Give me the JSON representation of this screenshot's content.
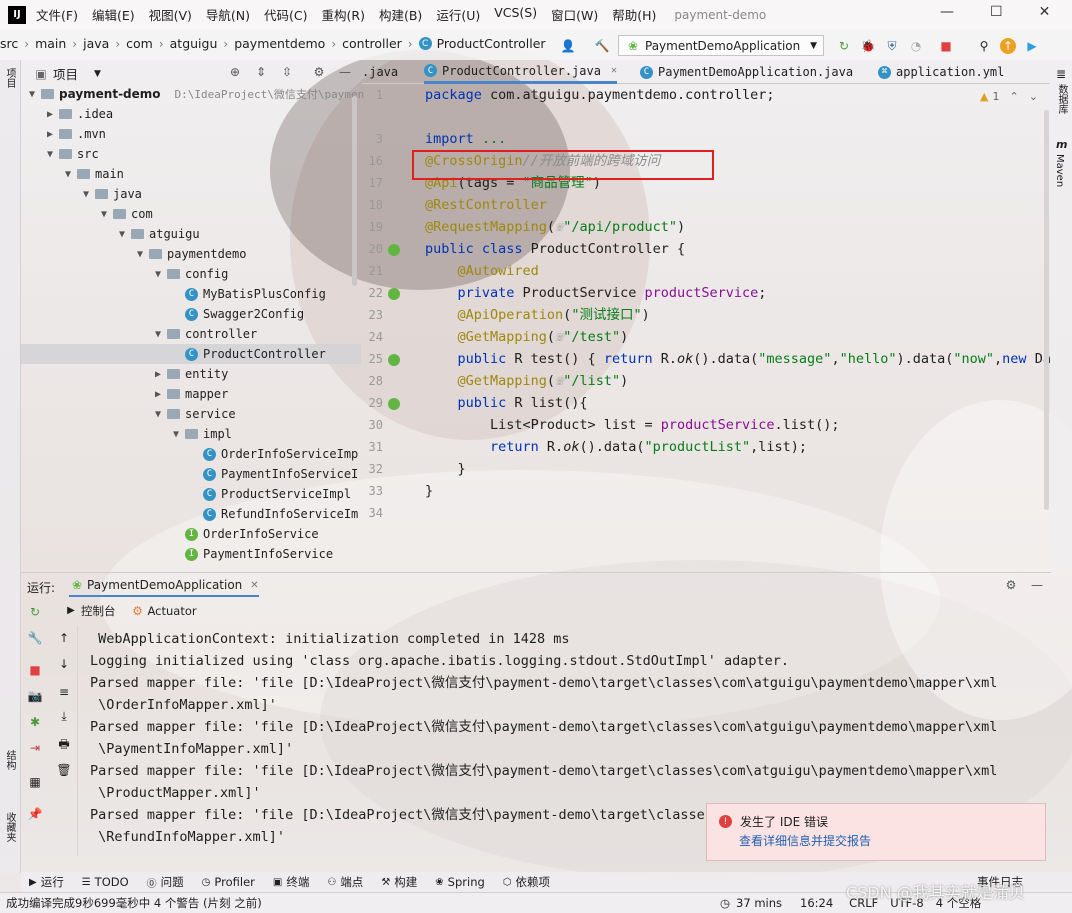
{
  "app": {
    "title": "payment-demo",
    "logo": "IJ"
  },
  "menu": [
    "文件(F)",
    "编辑(E)",
    "视图(V)",
    "导航(N)",
    "代码(C)",
    "重构(R)",
    "构建(B)",
    "运行(U)",
    "VCS(S)",
    "窗口(W)",
    "帮助(H)"
  ],
  "breadcrumb": [
    "src",
    "main",
    "java",
    "com",
    "atguigu",
    "paymentdemo",
    "controller",
    "ProductController"
  ],
  "run_config": "PaymentDemoApplication",
  "left_strip": {
    "project": "项目",
    "structure": "结构",
    "favorites": "收藏夹"
  },
  "right_strip": {
    "database": "数据库",
    "maven": "Maven"
  },
  "project_panel": {
    "title": "项目",
    "root_name": "payment-demo",
    "root_path": "D:\\IdeaProject\\微信支付\\paymen"
  },
  "tree": [
    {
      "label": ".idea",
      "kind": "folder",
      "depth": 1,
      "arrow": "▶"
    },
    {
      "label": ".mvn",
      "kind": "folder",
      "depth": 1,
      "arrow": "▶"
    },
    {
      "label": "src",
      "kind": "folder",
      "depth": 1,
      "arrow": "▼"
    },
    {
      "label": "main",
      "kind": "folder",
      "depth": 2,
      "arrow": "▼"
    },
    {
      "label": "java",
      "kind": "folder",
      "depth": 3,
      "arrow": "▼"
    },
    {
      "label": "com",
      "kind": "folder",
      "depth": 4,
      "arrow": "▼"
    },
    {
      "label": "atguigu",
      "kind": "folder",
      "depth": 5,
      "arrow": "▼"
    },
    {
      "label": "paymentdemo",
      "kind": "folder",
      "depth": 6,
      "arrow": "▼"
    },
    {
      "label": "config",
      "kind": "folder",
      "depth": 7,
      "arrow": "▼"
    },
    {
      "label": "MyBatisPlusConfig",
      "kind": "class",
      "depth": 8,
      "arrow": ""
    },
    {
      "label": "Swagger2Config",
      "kind": "class",
      "depth": 8,
      "arrow": ""
    },
    {
      "label": "controller",
      "kind": "folder",
      "depth": 7,
      "arrow": "▼"
    },
    {
      "label": "ProductController",
      "kind": "class",
      "depth": 8,
      "arrow": "",
      "selected": true
    },
    {
      "label": "entity",
      "kind": "folder",
      "depth": 7,
      "arrow": "▶"
    },
    {
      "label": "mapper",
      "kind": "folder",
      "depth": 7,
      "arrow": "▶"
    },
    {
      "label": "service",
      "kind": "folder",
      "depth": 7,
      "arrow": "▼"
    },
    {
      "label": "impl",
      "kind": "folder",
      "depth": 8,
      "arrow": "▼"
    },
    {
      "label": "OrderInfoServiceImp",
      "kind": "class",
      "depth": 9,
      "arrow": ""
    },
    {
      "label": "PaymentInfoServiceI",
      "kind": "class",
      "depth": 9,
      "arrow": ""
    },
    {
      "label": "ProductServiceImpl",
      "kind": "class",
      "depth": 9,
      "arrow": ""
    },
    {
      "label": "RefundInfoServiceIm",
      "kind": "class",
      "depth": 9,
      "arrow": ""
    },
    {
      "label": "OrderInfoService",
      "kind": "interface",
      "depth": 8,
      "arrow": ""
    },
    {
      "label": "PaymentInfoService",
      "kind": "interface",
      "depth": 8,
      "arrow": ""
    }
  ],
  "editor_tabs": [
    {
      "label": ".java",
      "active": false
    },
    {
      "label": "ProductController.java",
      "active": true
    },
    {
      "label": "PaymentDemoApplication.java",
      "active": false
    },
    {
      "label": "application.yml",
      "active": false
    }
  ],
  "editor": {
    "warning_count": "1",
    "line_numbers": [
      "1",
      "",
      "3",
      "16",
      "17",
      "18",
      "19",
      "20",
      "21",
      "22",
      "23",
      "24",
      "25",
      "28",
      "29",
      "30",
      "31",
      "32",
      "33",
      "34"
    ],
    "lines": [
      [
        {
          "t": "package ",
          "c": "kw"
        },
        {
          "t": "com.atguigu.paymentdemo.controller;",
          "c": ""
        }
      ],
      [],
      [
        {
          "t": "import ",
          "c": "kw"
        },
        {
          "t": "...",
          "c": "str"
        }
      ],
      [
        {
          "t": "@CrossOrigin",
          "c": "an"
        },
        {
          "t": "//开放前端的跨域访问",
          "c": "cm"
        }
      ],
      [
        {
          "t": "@Api",
          "c": "an"
        },
        {
          "t": "(tags = ",
          "c": ""
        },
        {
          "t": "\"商品管理\"",
          "c": "str"
        },
        {
          "t": ")",
          "c": ""
        }
      ],
      [
        {
          "t": "@RestController",
          "c": "an"
        }
      ],
      [
        {
          "t": "@RequestMapping",
          "c": "an"
        },
        {
          "t": "(",
          "c": ""
        },
        {
          "t": "☏",
          "c": "cm"
        },
        {
          "t": "\"/api/product\"",
          "c": "str"
        },
        {
          "t": ")",
          "c": ""
        }
      ],
      [
        {
          "t": "public class ",
          "c": "kw"
        },
        {
          "t": "ProductController {",
          "c": ""
        }
      ],
      [
        {
          "t": "    @Autowired",
          "c": "an"
        }
      ],
      [
        {
          "t": "    private ",
          "c": "kw"
        },
        {
          "t": "ProductService ",
          "c": ""
        },
        {
          "t": "productService",
          "c": "fld"
        },
        {
          "t": ";",
          "c": ""
        }
      ],
      [
        {
          "t": "    @ApiOperation",
          "c": "an"
        },
        {
          "t": "(",
          "c": ""
        },
        {
          "t": "\"测试接口\"",
          "c": "str"
        },
        {
          "t": ")",
          "c": ""
        }
      ],
      [
        {
          "t": "    @GetMapping",
          "c": "an"
        },
        {
          "t": "(",
          "c": ""
        },
        {
          "t": "☏",
          "c": "cm"
        },
        {
          "t": "\"/test\"",
          "c": "str"
        },
        {
          "t": ")",
          "c": ""
        }
      ],
      [
        {
          "t": "    public ",
          "c": "kw"
        },
        {
          "t": "R test() { ",
          "c": ""
        },
        {
          "t": "return ",
          "c": "kw"
        },
        {
          "t": "R.",
          "c": ""
        },
        {
          "t": "ok",
          "c": "it"
        },
        {
          "t": "().data(",
          "c": ""
        },
        {
          "t": "\"message\"",
          "c": "str"
        },
        {
          "t": ",",
          "c": ""
        },
        {
          "t": "\"hello\"",
          "c": "str"
        },
        {
          "t": ").data(",
          "c": ""
        },
        {
          "t": "\"now\"",
          "c": "str"
        },
        {
          "t": ",",
          "c": ""
        },
        {
          "t": "new ",
          "c": "kw"
        },
        {
          "t": "Date",
          "c": ""
        }
      ],
      [
        {
          "t": "    @GetMapping",
          "c": "an"
        },
        {
          "t": "(",
          "c": ""
        },
        {
          "t": "☏",
          "c": "cm"
        },
        {
          "t": "\"/list\"",
          "c": "str"
        },
        {
          "t": ")",
          "c": ""
        }
      ],
      [
        {
          "t": "    public ",
          "c": "kw"
        },
        {
          "t": "R list(){",
          "c": ""
        }
      ],
      [
        {
          "t": "        List<Product> list = ",
          "c": ""
        },
        {
          "t": "productService",
          "c": "fld"
        },
        {
          "t": ".list();",
          "c": ""
        }
      ],
      [
        {
          "t": "        return ",
          "c": "kw"
        },
        {
          "t": "R.",
          "c": ""
        },
        {
          "t": "ok",
          "c": "it"
        },
        {
          "t": "().data(",
          "c": ""
        },
        {
          "t": "\"productList\"",
          "c": "str"
        },
        {
          "t": ",list);",
          "c": ""
        }
      ],
      [
        {
          "t": "    }",
          "c": ""
        }
      ],
      [
        {
          "t": "}",
          "c": ""
        }
      ],
      []
    ]
  },
  "run_panel": {
    "label": "运行:",
    "config_tab": "PaymentDemoApplication",
    "tabs": [
      "控制台",
      "Actuator"
    ],
    "console": [
      " WebApplicationContext: initialization completed in 1428 ms",
      "Logging initialized using 'class org.apache.ibatis.logging.stdout.StdOutImpl' adapter.",
      "Parsed mapper file: 'file [D:\\IdeaProject\\微信支付\\payment-demo\\target\\classes\\com\\atguigu\\paymentdemo\\mapper\\xml",
      " \\OrderInfoMapper.xml]'",
      "Parsed mapper file: 'file [D:\\IdeaProject\\微信支付\\payment-demo\\target\\classes\\com\\atguigu\\paymentdemo\\mapper\\xml",
      " \\PaymentInfoMapper.xml]'",
      "Parsed mapper file: 'file [D:\\IdeaProject\\微信支付\\payment-demo\\target\\classes\\com\\atguigu\\paymentdemo\\mapper\\xml",
      " \\ProductMapper.xml]'",
      "Parsed mapper file: 'file [D:\\IdeaProject\\微信支付\\payment-demo\\target\\classes\\",
      " \\RefundInfoMapper.xml]'"
    ]
  },
  "toast": {
    "title": "发生了 IDE 错误",
    "link": "查看详细信息并提交报告"
  },
  "bottom_tools": [
    "运行",
    "TODO",
    "问题",
    "Profiler",
    "终端",
    "端点",
    "构建",
    "Spring",
    "依赖项"
  ],
  "event_log": "事件日志",
  "status": {
    "message": "成功编译完成9秒699毫秒中 4 个警告 (片刻 之前)",
    "time_spent": "37 mins",
    "position": "16:24",
    "line_sep": "CRLF",
    "encoding": "UTF-8",
    "indent": "4 个空格",
    "watermark": "CSDN @我其实就是蒲贝"
  },
  "colors": {
    "keyword": "#0033b3",
    "annotation": "#9e880d",
    "string": "#067d17",
    "field": "#871094",
    "highlight_box": "#e02020"
  }
}
